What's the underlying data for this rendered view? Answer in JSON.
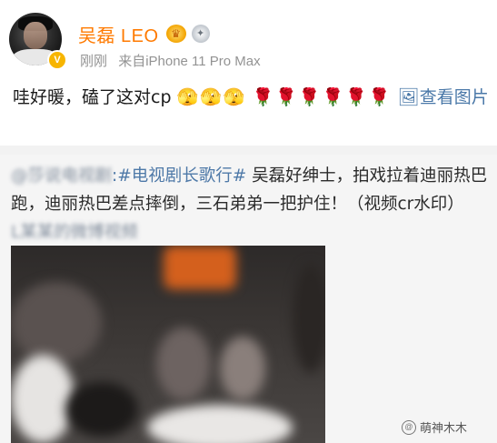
{
  "post": {
    "author": "吴磊 LEO",
    "time": "刚刚",
    "source": "来自iPhone 11 Pro Max",
    "text_main": "哇好暖，磕了这对cp",
    "face_emojis": "🫣🫣🫣",
    "rose_emojis": "🌹🌹🌹🌹🌹🌹",
    "view_images": "查看图片",
    "view_images_icon": "image-icon"
  },
  "repost": {
    "blurred_user": "@莎说电视剧",
    "separator": ":",
    "hashtag": "#电视剧长歌行#",
    "text": " 吴磊好绅士，拍戏拉着迪丽热巴跑，迪丽热巴差点摔倒，三石弟弟一把护住！（视频cr水印）",
    "blurred_link": "L某某的微博视频"
  },
  "watermark": {
    "text": "萌神木木",
    "icon": "at-icon"
  },
  "colors": {
    "username": "#ff7a00",
    "link": "#4e79a8",
    "meta": "#939393"
  }
}
